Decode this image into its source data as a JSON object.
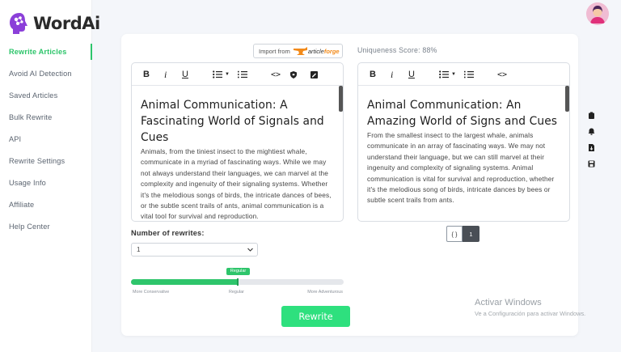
{
  "app": {
    "name": "WordAi"
  },
  "sidebar": {
    "items": [
      {
        "label": "Rewrite Articles",
        "active": true
      },
      {
        "label": "Avoid AI Detection"
      },
      {
        "label": "Saved Articles"
      },
      {
        "label": "Bulk Rewrite"
      },
      {
        "label": "API"
      },
      {
        "label": "Rewrite Settings"
      },
      {
        "label": "Usage Info"
      },
      {
        "label": "Affiliate"
      },
      {
        "label": "Help Center"
      }
    ]
  },
  "import": {
    "prefix": "Import from",
    "brand": "article",
    "brand_accent": "forge"
  },
  "uniqueness": {
    "label": "Uniqueness Score: 88%"
  },
  "editor_toolbar": {
    "bold": "B",
    "italic": "i",
    "underline": "U",
    "code": "<>"
  },
  "original": {
    "title": "Animal Communication: A Fascinating World of Signals and Cues",
    "body": "Animals, from the tiniest insect to the mightiest whale, communicate in a myriad of fascinating ways. While we may not always understand their languages, we can marvel at the complexity and ingenuity of their signaling systems. Whether it's the melodious songs of birds, the intricate dances of bees, or the subtle scent trails of ants, animal communication is a vital tool for survival and reproduction."
  },
  "rewritten": {
    "title": "Animal Communication: An Amazing World of Signs and Cues",
    "body": "From the smallest insect to the largest whale, animals communicate in an array of fascinating ways. We may not understand their language, but we can still marvel at their ingenuity and complexity of signaling systems. Animal communication is vital for survival and reproduction, whether it's the melodious song of birds, intricate dances by bees or subtle scent trails from ants."
  },
  "rewrites": {
    "label": "Number of rewrites:",
    "selected": "1"
  },
  "slider": {
    "tooltip": "Regular",
    "value": 0.5,
    "left_label": "More Conservative",
    "mid_label": "Regular",
    "right_label": "More Adventurous"
  },
  "rewrite_button": {
    "label": "Rewrite"
  },
  "pager": {
    "brace": "{ }",
    "current": "1"
  },
  "watermark": {
    "title": "Activar Windows",
    "subtitle": "Ve a Configuración para activar Windows."
  },
  "colors": {
    "accent": "#2ec56b",
    "button": "#2ee07e",
    "brand_purple": "#8b3fd9",
    "forge_orange": "#f28a1a"
  }
}
